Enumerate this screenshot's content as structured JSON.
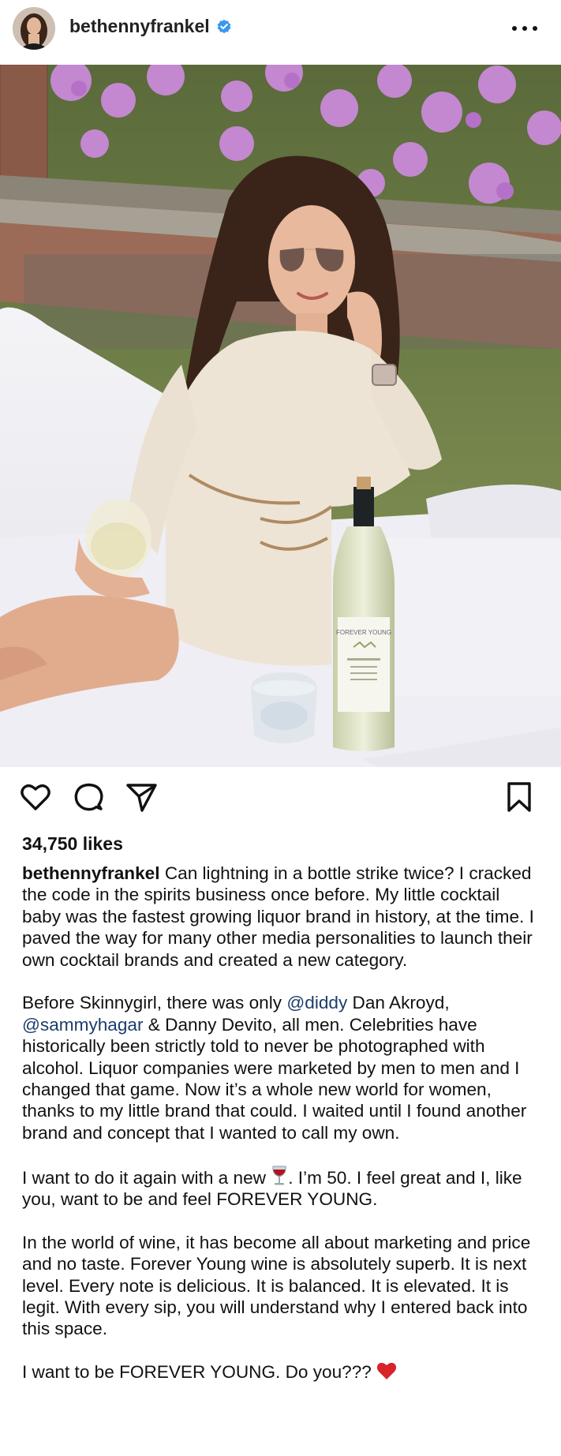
{
  "post": {
    "username": "bethennyfrankel",
    "likes": "34,750 likes",
    "icons": {
      "verified": "verified-badge-icon",
      "more": "more-options-icon",
      "like": "heart-icon",
      "comment": "comment-icon",
      "share": "send-icon",
      "save": "bookmark-icon"
    },
    "colors": {
      "verified": "#3897f0",
      "mention": "#1c3d6b",
      "heart_emoji": "#d8232a"
    },
    "photo": {
      "bottle_label": "FOREVER YOUNG"
    },
    "caption": {
      "p1": "Can lightning in a bottle strike twice? I cracked the code in the spirits business once before. My little cocktail baby was the fastest growing liquor brand in history, at the time. I paved the way for many other media personalities to launch their own cocktail brands and created a new category.",
      "p2a": "Before Skinnygirl, there was only ",
      "mention1": "@diddy",
      "p2b": " Dan Akroyd, ",
      "mention2": "@sammyhagar",
      "p2c": " & Danny Devito, all men. Celebrities have historically been strictly told to never be photographed with alcohol. Liquor companies were marketed by men to men and I changed that game. Now it’s a whole new world for women, thanks to my little brand that could. I waited until I found another brand and concept that I wanted to call my own.",
      "p3a": "I want to do it again with a new ",
      "p3b": ". I’m 50. I feel great and I, like you, want to be and feel FOREVER YOUNG.",
      "p4": "In the world of wine, it has become all about marketing and price and no taste. Forever Young wine is absolutely superb. It is next level. Every note is delicious. It is balanced. It is elevated. It is legit. With every sip, you will understand why I entered back into this space.",
      "p5": "I want to be FOREVER YOUNG. Do you??? "
    }
  }
}
